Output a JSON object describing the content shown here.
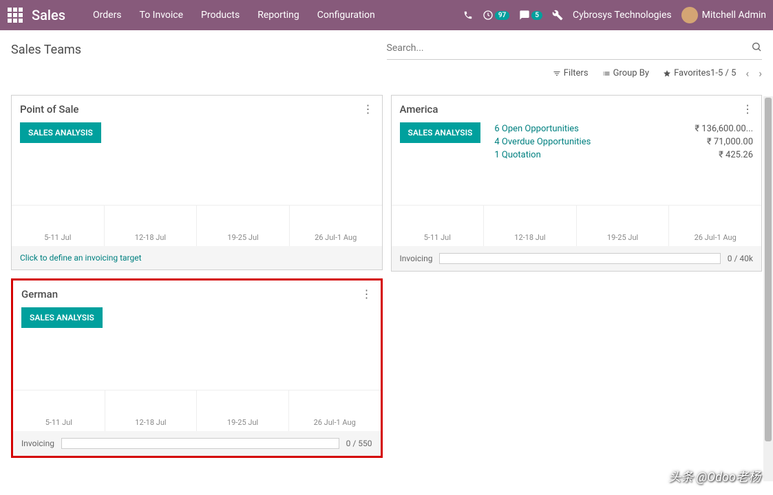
{
  "topbar": {
    "brand": "Sales",
    "nav": [
      "Orders",
      "To Invoice",
      "Products",
      "Reporting",
      "Configuration"
    ],
    "activity_badge": "97",
    "discuss_badge": "5",
    "company": "Cybrosys Technologies",
    "user": "Mitchell Admin"
  },
  "page": {
    "title": "Sales Teams",
    "search_placeholder": "Search...",
    "filters_label": "Filters",
    "groupby_label": "Group By",
    "favorites_label": "Favorites",
    "pager": "1-5 / 5"
  },
  "cards": {
    "pos": {
      "title": "Point of Sale",
      "btn": "SALES ANALYSIS",
      "footer": "Click to define an invoicing target"
    },
    "america": {
      "title": "America",
      "btn": "SALES ANALYSIS",
      "stats": [
        {
          "label": "6 Open Opportunities",
          "value": "₹ 136,600.00..."
        },
        {
          "label": "4 Overdue Opportunities",
          "value": "₹ 71,000.00"
        },
        {
          "label": "1 Quotation",
          "value": "₹ 425.26"
        }
      ],
      "invoicing_label": "Invoicing",
      "invoicing_text": "0 / 40k"
    },
    "german": {
      "title": "German",
      "btn": "SALES ANALYSIS",
      "invoicing_label": "Invoicing",
      "invoicing_text": "0 / 550"
    }
  },
  "chart_data": [
    {
      "type": "bar",
      "team": "Point of Sale",
      "categories": [
        "5-11 Jul",
        "12-18 Jul",
        "19-25 Jul",
        "26 Jul-1 Aug"
      ],
      "values": [
        0,
        0,
        0,
        0
      ]
    },
    {
      "type": "bar",
      "team": "America",
      "categories": [
        "5-11 Jul",
        "12-18 Jul",
        "19-25 Jul",
        "26 Jul-1 Aug"
      ],
      "values": [
        0,
        0,
        0,
        0
      ]
    },
    {
      "type": "bar",
      "team": "German",
      "categories": [
        "5-11 Jul",
        "12-18 Jul",
        "19-25 Jul",
        "26 Jul-1 Aug"
      ],
      "values": [
        0,
        0,
        0,
        0
      ]
    }
  ],
  "watermark": "头条 @Odoo老杨"
}
